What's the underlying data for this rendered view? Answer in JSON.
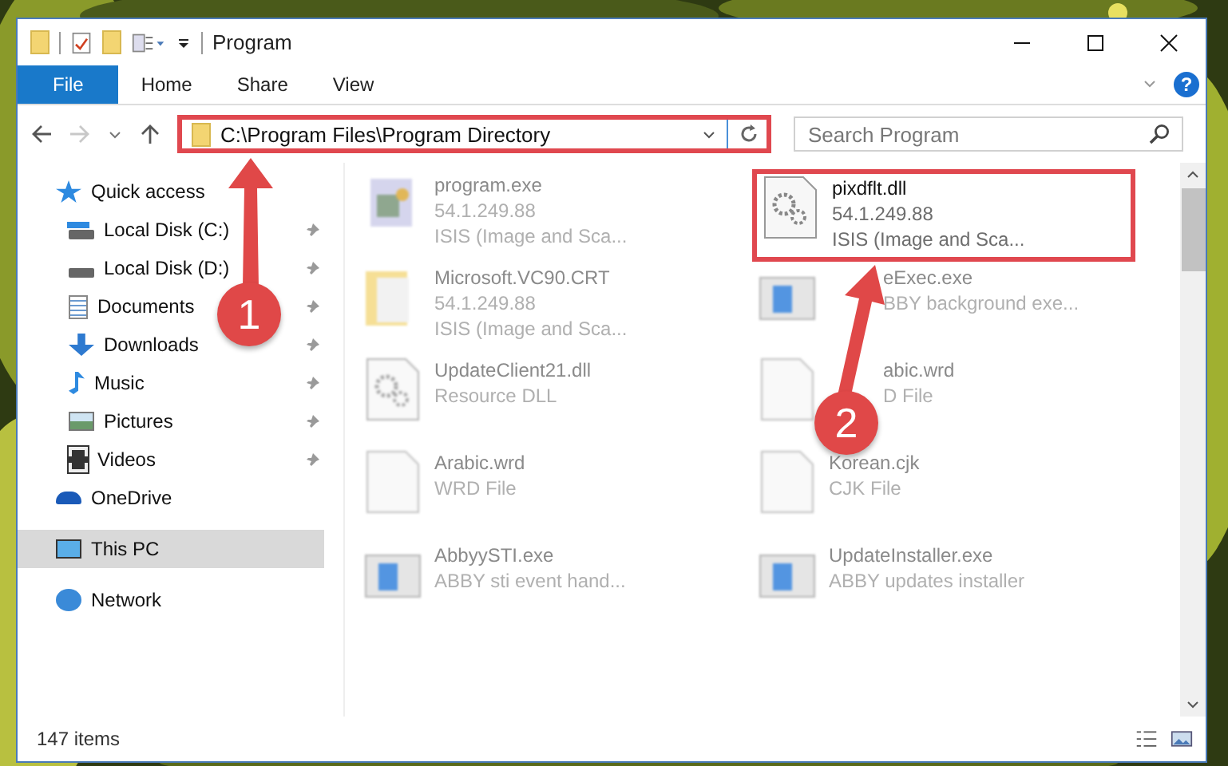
{
  "window": {
    "title": "Program"
  },
  "ribbon": {
    "tabs": [
      {
        "label": "File",
        "kind": "file",
        "selected": false
      },
      {
        "label": "Home",
        "kind": "tab",
        "selected": false
      },
      {
        "label": "Share",
        "kind": "tab",
        "selected": false
      },
      {
        "label": "View",
        "kind": "tab",
        "selected": false
      }
    ],
    "help": "?"
  },
  "address": {
    "path": "C:\\Program Files\\Program Directory",
    "highlighted": true
  },
  "search": {
    "placeholder": "Search Program"
  },
  "nav": [
    {
      "label": "Quick access",
      "kind": "star",
      "selected": false,
      "children": [
        {
          "label": "Local Disk (C:)",
          "kind": "drive-c",
          "pinned": true,
          "selected": false
        },
        {
          "label": "Local Disk (D:)",
          "kind": "drive",
          "pinned": true,
          "selected": false
        },
        {
          "label": "Documents",
          "kind": "document",
          "pinned": true,
          "selected": false
        },
        {
          "label": "Downloads",
          "kind": "download",
          "pinned": true,
          "selected": false
        },
        {
          "label": "Music",
          "kind": "music",
          "pinned": true,
          "selected": false
        },
        {
          "label": "Pictures",
          "kind": "pictures",
          "pinned": true,
          "selected": false
        },
        {
          "label": "Videos",
          "kind": "videos",
          "pinned": true,
          "selected": false
        }
      ]
    },
    {
      "label": "OneDrive",
      "kind": "cloud",
      "selected": false
    },
    {
      "label": "This PC",
      "kind": "pc",
      "selected": true
    },
    {
      "label": "Network",
      "kind": "network",
      "selected": false
    }
  ],
  "files": [
    {
      "name": "program.exe",
      "lines": [
        "54.1.249.88",
        "ISIS (Image and Sca..."
      ],
      "kind": "app",
      "blurred": true,
      "highlighted": false,
      "covered": false
    },
    {
      "name": "pixdflt.dll",
      "lines": [
        "54.1.249.88",
        "ISIS (Image and Sca..."
      ],
      "kind": "dll",
      "blurred": false,
      "highlighted": true,
      "covered": false
    },
    {
      "name": "Microsoft.VC90.CRT",
      "lines": [
        "54.1.249.88",
        "ISIS (Image and Sca..."
      ],
      "kind": "folder",
      "blurred": true,
      "highlighted": false,
      "covered": false
    },
    {
      "name": "eExec.exe",
      "lines": [
        "BBY background exe..."
      ],
      "kind": "window",
      "blurred": true,
      "highlighted": false,
      "covered": true
    },
    {
      "name": "UpdateClient21.dll",
      "lines": [
        "Resource DLL"
      ],
      "kind": "dll",
      "blurred": true,
      "highlighted": false,
      "covered": false
    },
    {
      "name": "abic.wrd",
      "lines": [
        "D File"
      ],
      "kind": "file",
      "blurred": true,
      "highlighted": false,
      "covered": true
    },
    {
      "name": "Arabic.wrd",
      "lines": [
        "WRD File"
      ],
      "kind": "file",
      "blurred": true,
      "highlighted": false,
      "covered": false
    },
    {
      "name": "Korean.cjk",
      "lines": [
        "CJK File"
      ],
      "kind": "file",
      "blurred": true,
      "highlighted": false,
      "covered": false
    },
    {
      "name": "AbbyySTI.exe",
      "lines": [
        "ABBY sti event hand..."
      ],
      "kind": "window",
      "blurred": true,
      "highlighted": false,
      "covered": false
    },
    {
      "name": "UpdateInstaller.exe",
      "lines": [
        "ABBY updates installer"
      ],
      "kind": "window",
      "blurred": true,
      "highlighted": false,
      "covered": false
    }
  ],
  "status": {
    "count": "147 items"
  },
  "callouts": [
    {
      "number": "1"
    },
    {
      "number": "2"
    }
  ]
}
